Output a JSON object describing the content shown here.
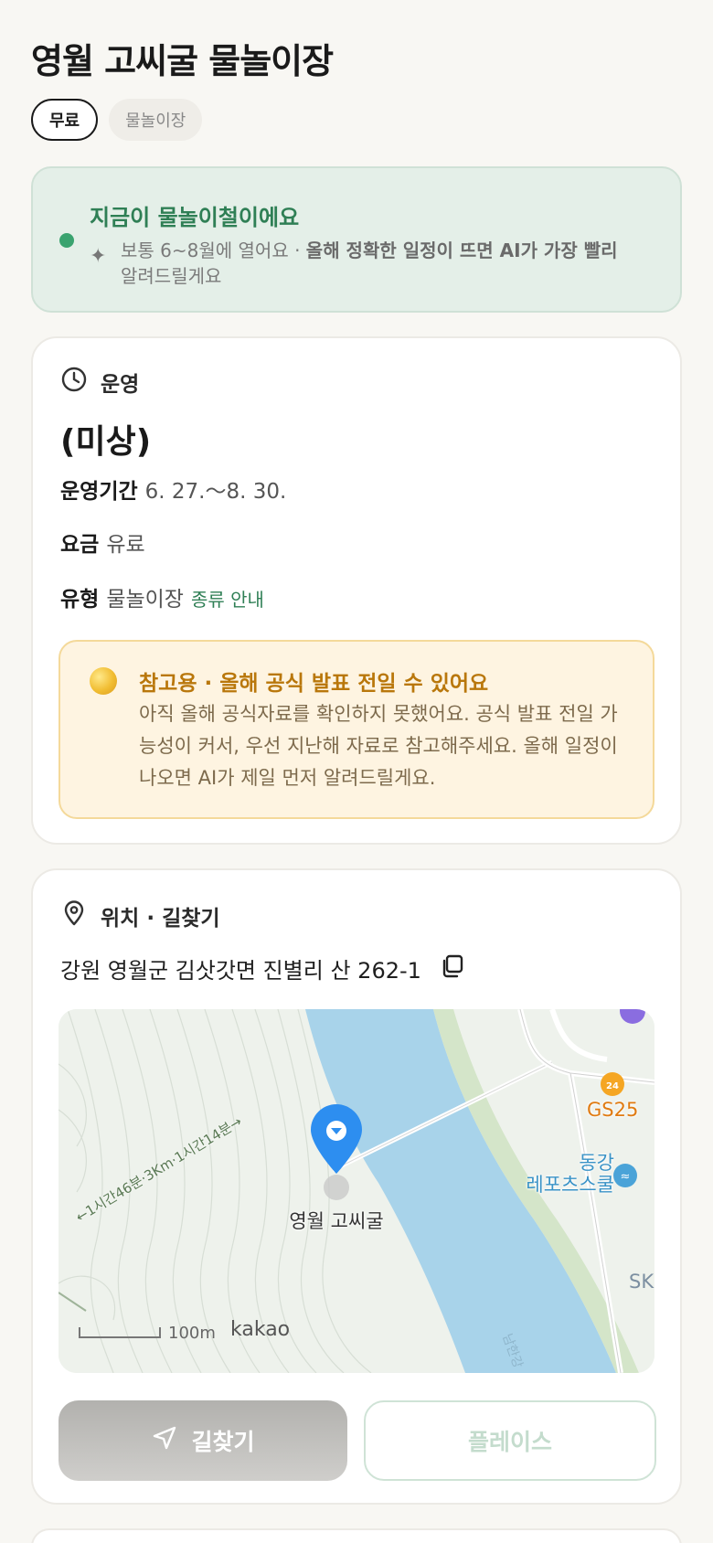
{
  "title": "영월 고씨굴 물놀이장",
  "tags": [
    {
      "label": "무료"
    },
    {
      "label": "물놀이장"
    }
  ],
  "season_banner": {
    "heading": "지금이 물놀이철이에요",
    "body_plain": "보통 6~8월에 열어요 · ",
    "body_bold": "올해 정확한 일정이 뜨면 AI가 가장 빨리",
    "body_tail": "알려드릴게요",
    "accent_color": "#2f7f55"
  },
  "operation": {
    "section_title": "운영",
    "status": "(미상)",
    "period_label": "운영기간",
    "period_value": "6. 27.～8. 30.",
    "fee_label": "요금",
    "fee_value": "유료",
    "type_label": "유형",
    "type_value": "물놀이장",
    "type_link": "종류 안내",
    "notice": {
      "heading": "참고용 · 올해 공식 발표 전일 수 있어요",
      "body": "아직 올해 공식자료를 확인하지 못했어요. 공식 발표 전일 가능성이 커서, 우선 지난해 자료로 참고해주세요. 올해 일정이 나오면 AI가 제일 먼저 알려드릴게요.",
      "accent_color": "#b9770b"
    }
  },
  "location": {
    "section_title": "위치 · 길찾기",
    "address": "강원 영월군 김삿갓면 진별리 산 262-1",
    "map": {
      "pin_label": "영월 고씨굴",
      "route_label": "←1시간46분·3Km·1시간14분→",
      "poi_convenience": "GS25",
      "poi_leisure_line1": "동강",
      "poi_leisure_line2": "레포츠스쿨",
      "edge_label": "SK",
      "river_label": "남한강",
      "scale_label": "100m",
      "brand": "kakao",
      "pin_color": "#2d8ef0"
    },
    "directions_button": "길찾기",
    "place_button": "플레이스"
  }
}
